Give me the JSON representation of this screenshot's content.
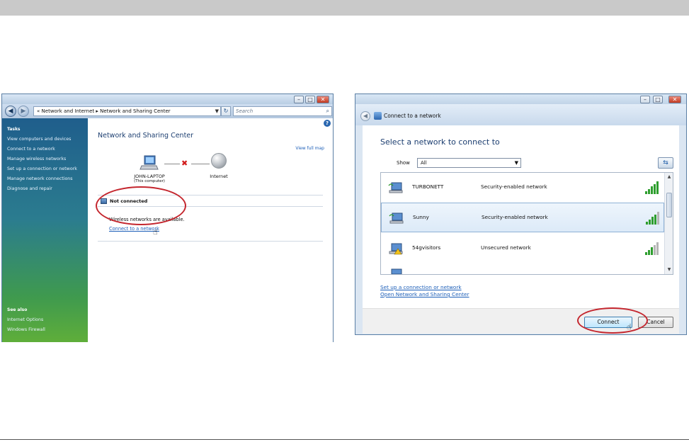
{
  "left_window": {
    "address": {
      "prefix": "«",
      "crumb1": "Network and Internet",
      "sep": "▸",
      "crumb2": "Network and Sharing Center"
    },
    "search_placeholder": "Search",
    "sidebar": {
      "tasks_header": "Tasks",
      "tasks": [
        "View computers and devices",
        "Connect to a network",
        "Manage wireless networks",
        "Set up a connection or network",
        "Manage network connections",
        "Diagnose and repair"
      ],
      "see_also_header": "See also",
      "see_also": [
        "Internet Options",
        "Windows Firewall"
      ]
    },
    "content": {
      "title": "Network and Sharing Center",
      "view_full_map": "View full map",
      "computer_name": "JOHN-LAPTOP",
      "computer_sub": "(This computer)",
      "internet_label": "Internet",
      "status": "Not connected",
      "wireless_msg": "Wireless networks are available.",
      "connect_link": "Connect to a network"
    }
  },
  "right_window": {
    "header_title": "Connect to a network",
    "select_title": "Select a network to connect to",
    "show_label": "Show",
    "show_value": "All",
    "networks": [
      {
        "name": "TURBONETT",
        "security": "Security-enabled network",
        "bars": 5,
        "selected": false
      },
      {
        "name": "Sunny",
        "security": "Security-enabled network",
        "bars": 4,
        "selected": true
      },
      {
        "name": "54gvisitors",
        "security": "Unsecured network",
        "bars": 3,
        "selected": false
      }
    ],
    "links": [
      "Set up a connection or network",
      "Open Network and Sharing Center"
    ],
    "buttons": {
      "connect": "Connect",
      "cancel": "Cancel"
    }
  },
  "colors": {
    "highlight_ring": "#c4262e",
    "link": "#1d5fb8",
    "signal_green": "#2e9e2e",
    "signal_gray": "#b5b5b5"
  }
}
